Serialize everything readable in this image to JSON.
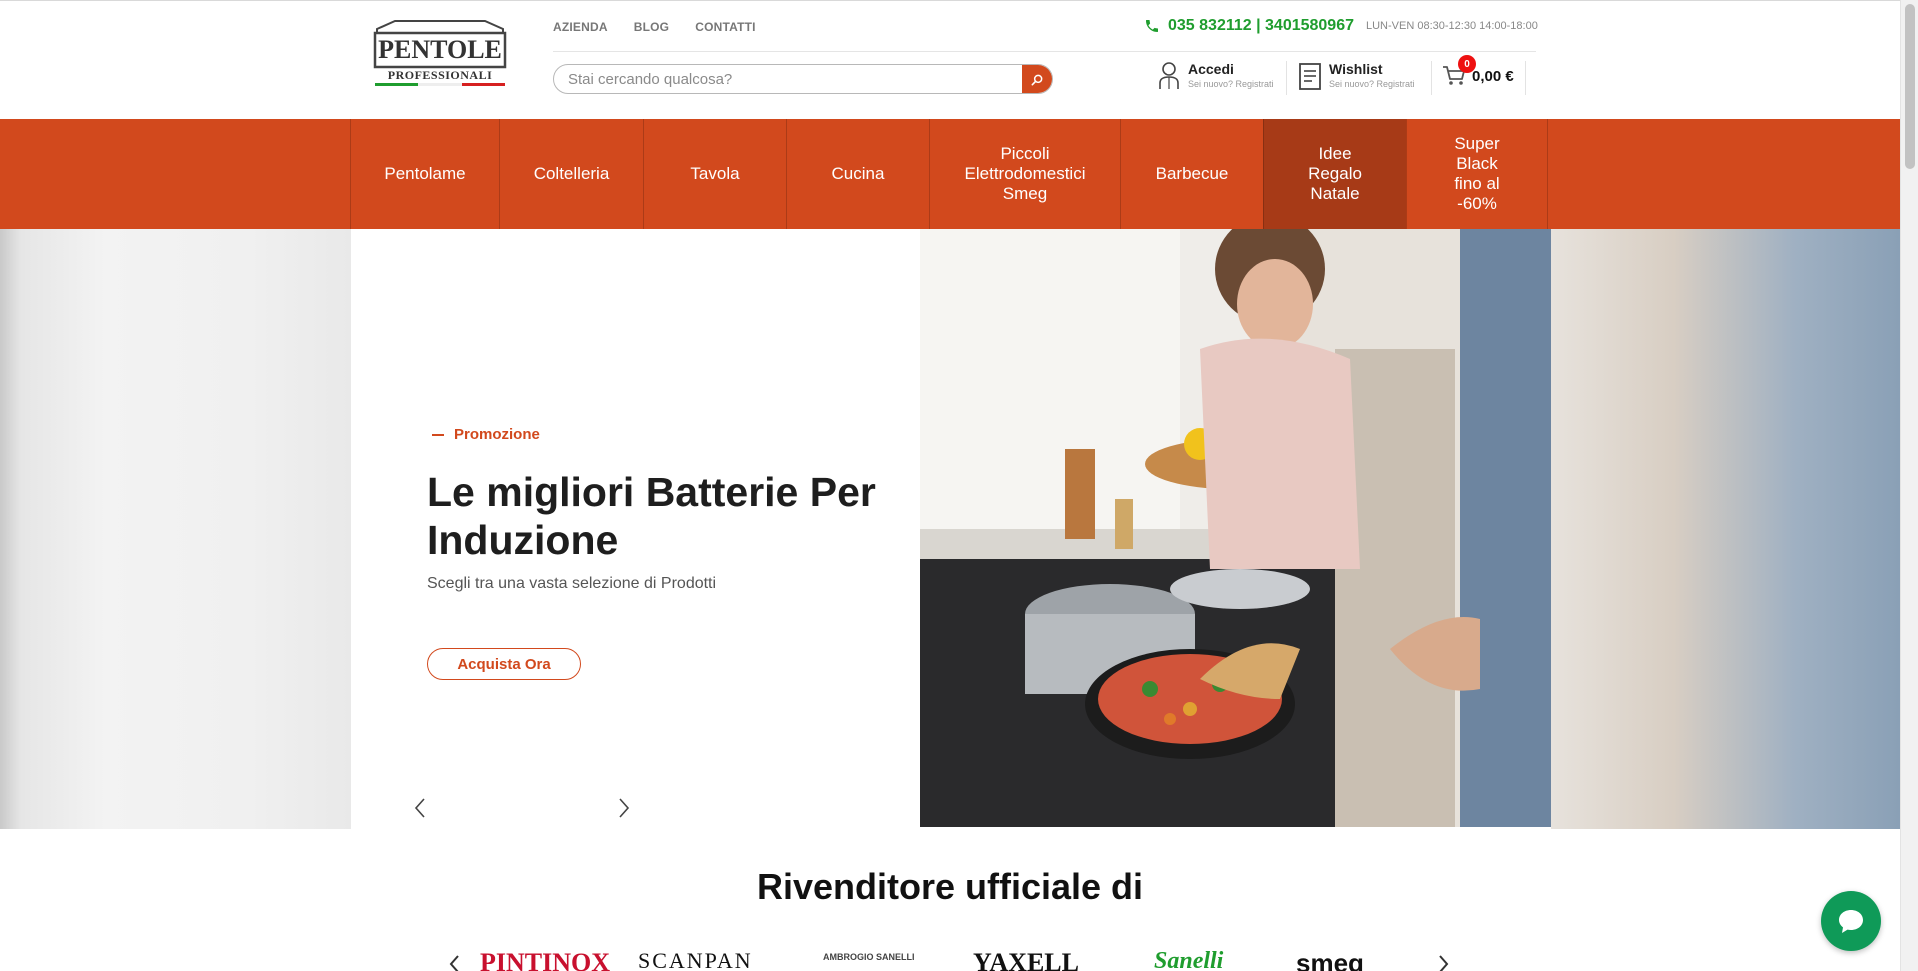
{
  "header": {
    "logo_alt": "Pentole Professionali",
    "logo_line1": "PENTOLE",
    "logo_line2": "PROFESSIONALI",
    "top_links": [
      "AZIENDA",
      "BLOG",
      "CONTATTI"
    ],
    "phone": "035 832112 | 3401580967",
    "hours": "LUN-VEN 08:30-12:30 14:00-18:00",
    "search_placeholder": "Stai cercando qualcosa?",
    "login_label": "Accedi",
    "login_sub": "Sei nuovo? Registrati",
    "wishlist_label": "Wishlist",
    "wishlist_sub": "Sei nuovo? Registrati",
    "cart_count": "0",
    "cart_total": "0,00 €"
  },
  "nav": {
    "items": [
      {
        "label": "Pentolame"
      },
      {
        "label": "Coltelleria"
      },
      {
        "label": "Tavola"
      },
      {
        "label": "Cucina"
      },
      {
        "label": "Piccoli\nElettrodomestici\nSmeg"
      },
      {
        "label": "Barbecue"
      },
      {
        "label": "Idee\nRegalo\nNatale"
      },
      {
        "label": "Super\nBlack\nfino al\n-60%"
      }
    ]
  },
  "hero": {
    "tag": "Promozione",
    "title": "Le migliori Batterie Per Induzione",
    "subtitle": "Scegli tra una vasta selezione di Prodotti",
    "cta": "Acquista Ora"
  },
  "brands": {
    "title": "Rivenditore ufficiale di",
    "logos": [
      "PINTINOX",
      "SCANPAN",
      "AMBROGIO SANELLI",
      "YAXELL",
      "Sanelli",
      "smeg"
    ]
  },
  "colors": {
    "accent": "#d2491d",
    "accent_dark": "#a73a17",
    "phone_green": "#1f9d2e",
    "chat_green": "#0f9a58"
  }
}
